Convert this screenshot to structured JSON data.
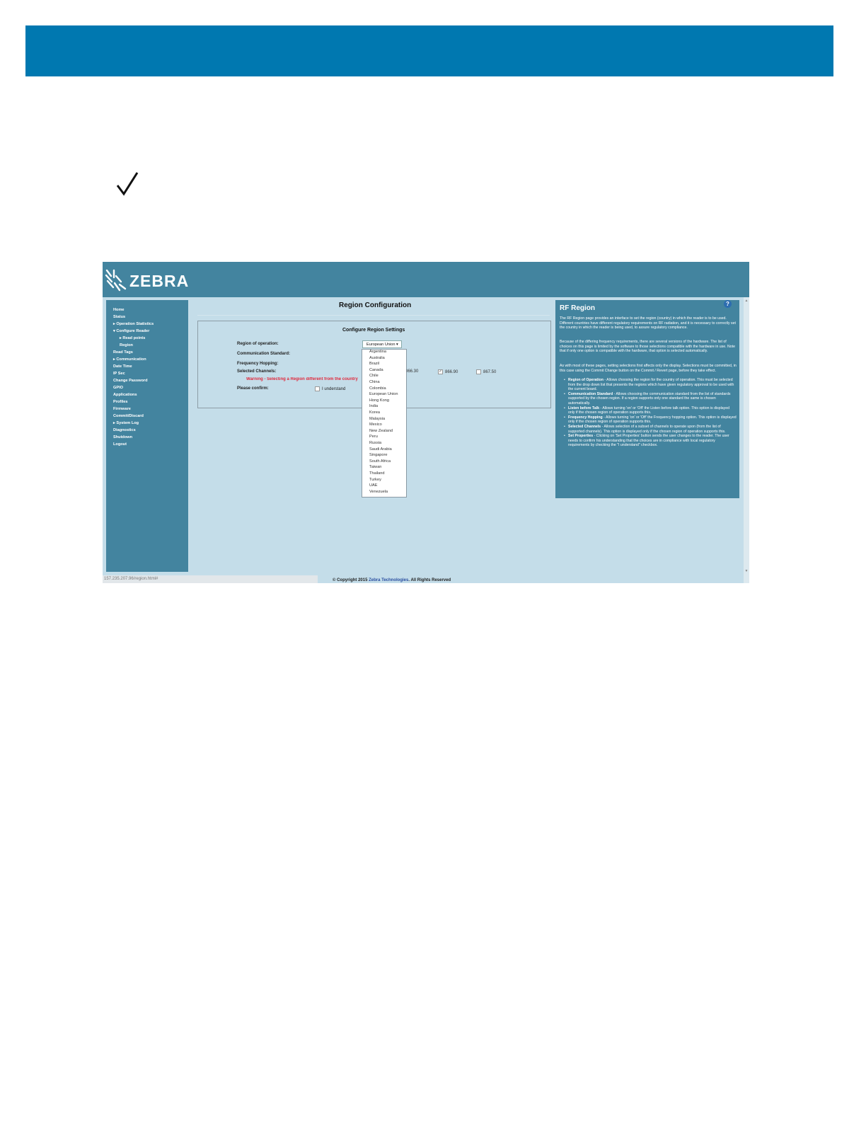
{
  "zebra_logo": "ZEBRA",
  "region_page": {
    "title": "Region Configuration",
    "box_title": "Configure Region Settings",
    "labels": {
      "region_of_operation": "Region of operation:",
      "communication_standard": "Communication Standard:",
      "frequency_hopping": "Frequency Hopping:",
      "selected_channels": "Selected Channels:",
      "please_confirm": "Please confirm:"
    },
    "selected_region": "European Union",
    "warning": "Warning - Selecting a Region different from the country",
    "channels": [
      "866.30",
      "866.90",
      "867.50"
    ],
    "confirm_label": "I understand",
    "dropdown_options": [
      "Argentina",
      "Australia",
      "Brazil",
      "Canada",
      "Chile",
      "China",
      "Colombia",
      "European Union",
      "Hong Kong",
      "India",
      "Korea",
      "Malaysia",
      "Mexico",
      "New Zealand",
      "Peru",
      "Russia",
      "Saudi Arabia",
      "Singapore",
      "South Africa",
      "Taiwan",
      "Thailand",
      "Turkey",
      "UAE",
      "Venezuela"
    ]
  },
  "nav": [
    "Home",
    "Status",
    "Operation Statistics",
    "Configure Reader",
    "Read points",
    "Region",
    "Read Tags",
    "Communication",
    "Date Time",
    "IP Sec",
    "Change Password",
    "GPIO",
    "Applications",
    "Profiles",
    "Firmware",
    "Commit/Discard",
    "System Log",
    "Diagnostics",
    "Shutdown",
    "Logout"
  ],
  "help": {
    "title": "RF Region",
    "icon": "?",
    "para1": "The RF Region page provides an interface to set the region (country) in which the reader is to be used. Different countries have different regulatory requirements on RF radiation, and it is necessary to correctly set the country in which the reader is being used, to assure regulatory compliance.",
    "para2": "Because of the differing frequency requirements, there are several versions of the hardware. The list of choices on this page is limited by the software to those selections compatible with the hardware in use. Note that if only one option is compatible with the hardware, that option is selected automatically.",
    "para3": "As with most of these pages, setting selections first affects only the display. Selections must be committed, in this case using the Commit Change button on the Commit / Revert page, before they take effect.",
    "items": [
      {
        "term": "Region of Operation",
        "text": " - Allows choosing the region for the country of operation. This must be selected from the drop down list that presents the regions which have given regulatory approval to be used with the current board."
      },
      {
        "term": "Communication Standard",
        "text": " - Allows choosing the communication standard from the list of standards supported by the chosen region. If a region supports only one standard the same is chosen automatically."
      },
      {
        "term": "Listen before Talk",
        "text": " - Allows turning 'on' or 'Off' the Listen before talk option. This option is displayed only if the chosen region of operation supports this."
      },
      {
        "term": "Frequency Hopping",
        "text": " - Allows turning 'on' or 'Off' the Frequency hopping option. This option is displayed only if the chosen region of operation supports this."
      },
      {
        "term": "Selected Channels",
        "text": " - Allows selection of a subset of channels to operate upon (from the list of supported channels). This option is displayed only if the chosen region of operation supports this."
      },
      {
        "term": "Set Properties",
        "text": " - Clicking on 'Set Properties' button sends the user changes to the reader. The user needs to confirm his understanding that the choices are in compliance with local regulatory requirements by checking the \"I understand\" checkbox."
      }
    ]
  },
  "status_url": "157.235.207.96/region.html#",
  "footer": {
    "prefix": "© Copyright 2015 ",
    "link": "Zebra Technologies",
    "suffix": ". All Rights Reserved"
  },
  "colors": {
    "doc_header": "#0078b0",
    "panel": "#43849f",
    "content_bg": "#c4dde9",
    "warning": "#e0283c"
  }
}
